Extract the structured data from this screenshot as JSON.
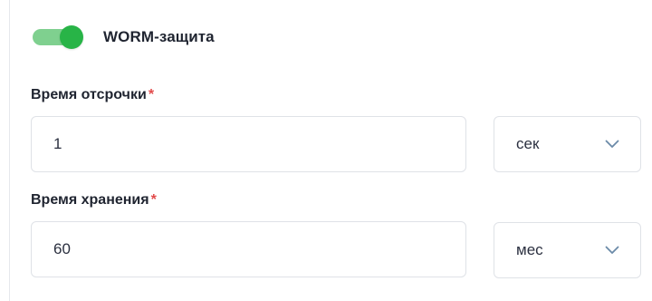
{
  "worm": {
    "label": "WORM-защита",
    "enabled": true,
    "on_color": "#28b447"
  },
  "grace_period": {
    "label": "Время отсрочки",
    "required_mark": "*",
    "value": "1",
    "unit": "сек"
  },
  "retention_period": {
    "label": "Время хранения",
    "required_mark": "*",
    "value": "60",
    "unit": "мес"
  },
  "icons": {
    "dropdown": "chevron-down-icon"
  },
  "colors": {
    "required": "#e24b4b",
    "border": "#dfe2e7"
  }
}
